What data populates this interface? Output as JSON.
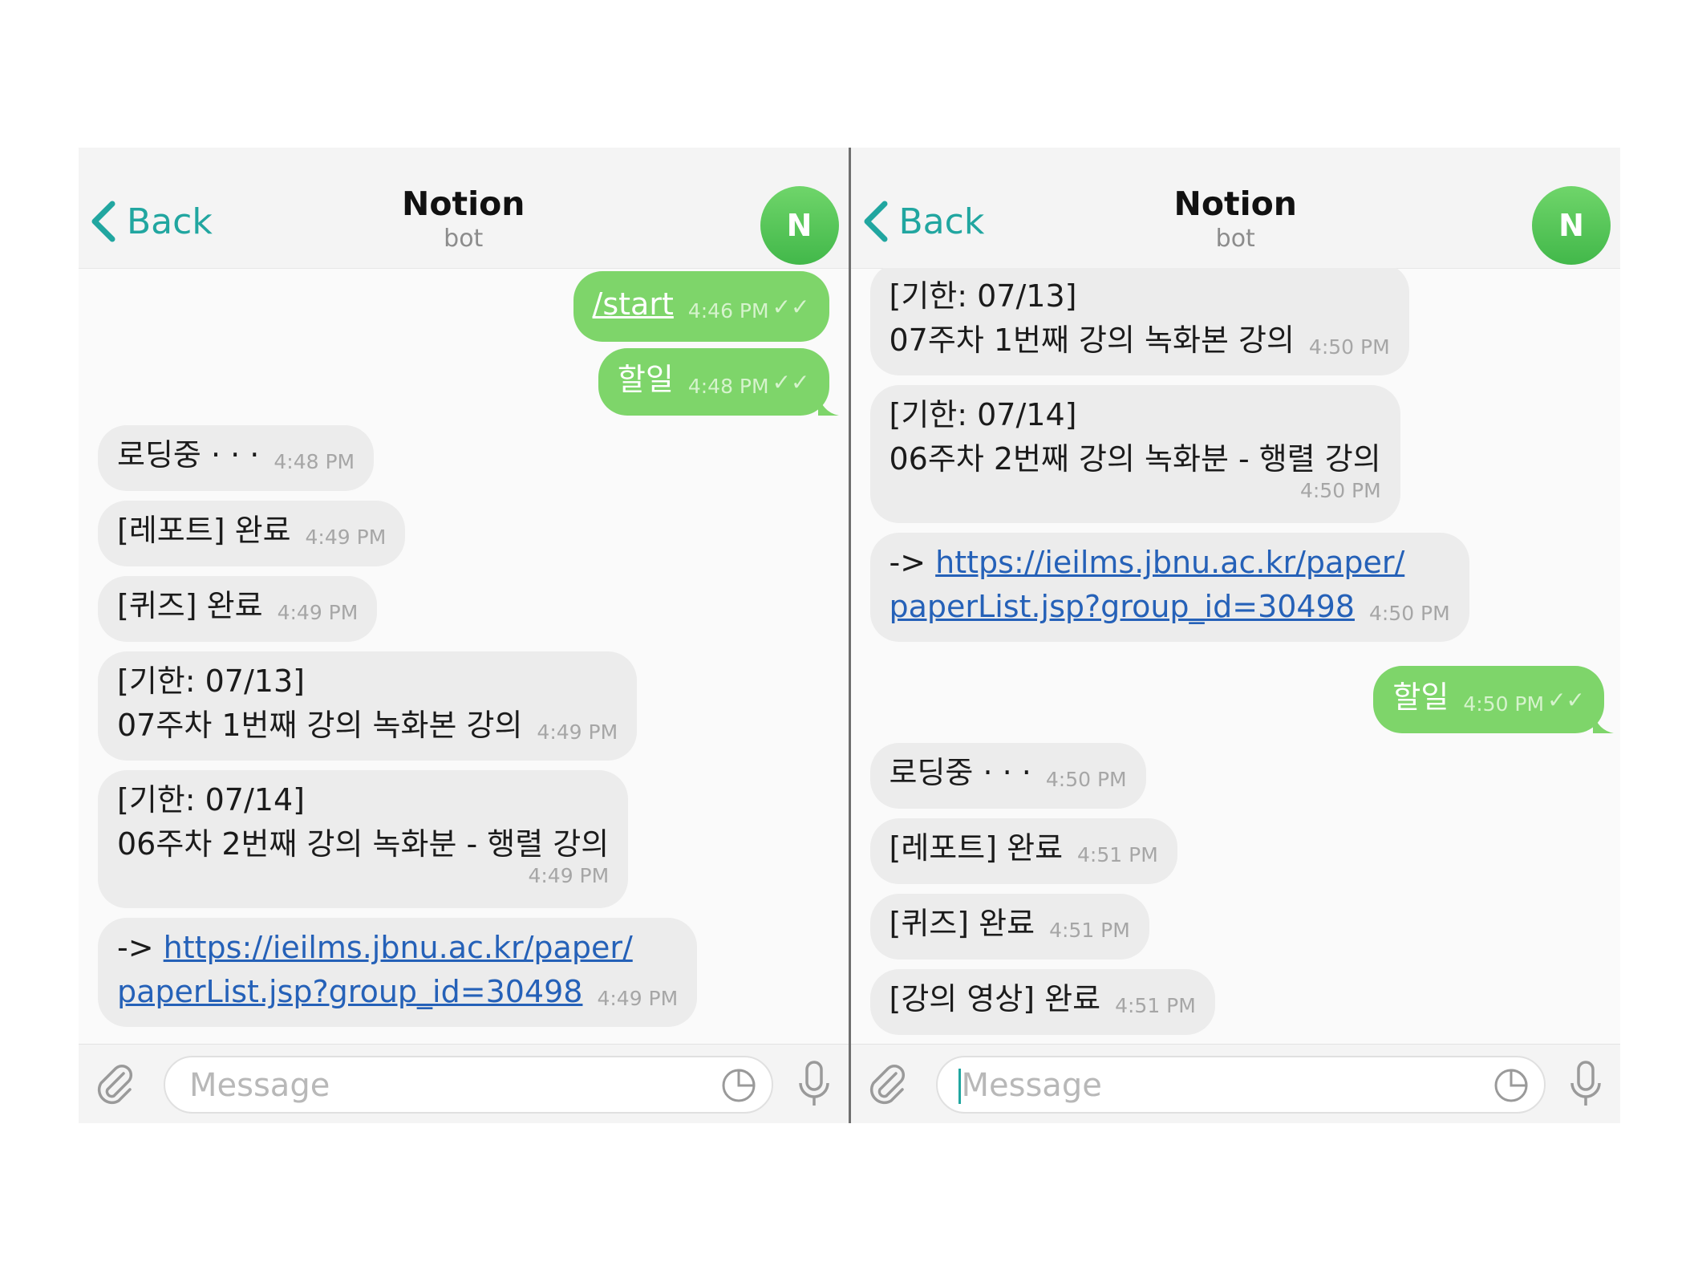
{
  "screens": [
    {
      "header": {
        "back_label": "Back",
        "title": "Notion",
        "subtitle": "bot",
        "avatar_letter": "N"
      },
      "messages": {
        "m1": {
          "text": "/start",
          "time": "4:46 PM"
        },
        "m2": {
          "text": "할일",
          "time": "4:48 PM"
        },
        "m3": {
          "text": "로딩중 · · ·",
          "time": "4:48 PM"
        },
        "m4": {
          "text": "[레포트] 완료",
          "time": "4:49 PM"
        },
        "m5": {
          "text": "[퀴즈] 완료",
          "time": "4:49 PM"
        },
        "m6": {
          "line1": "[기한: 07/13]",
          "line2": "07주차 1번째 강의 녹화본 강의",
          "time": "4:49 PM"
        },
        "m7": {
          "line1": "[기한: 07/14]",
          "line2": "06주차 2번째 강의 녹화분 - 행렬 강의",
          "time": "4:49 PM"
        },
        "m8": {
          "prefix": "-> ",
          "link1": "https://ieilms.jbnu.ac.kr/paper/",
          "link2": "paperList.jsp?group_id=30498",
          "time": "4:49 PM"
        }
      },
      "input": {
        "placeholder": "Message"
      }
    },
    {
      "header": {
        "back_label": "Back",
        "title": "Notion",
        "subtitle": "bot",
        "avatar_letter": "N"
      },
      "messages": {
        "m1": {
          "line1": "[기한: 07/13]",
          "line2": "07주차 1번째 강의 녹화본 강의",
          "time": "4:50 PM"
        },
        "m2": {
          "line1": "[기한: 07/14]",
          "line2": "06주차 2번째 강의 녹화분 - 행렬 강의",
          "time": "4:50 PM"
        },
        "m3": {
          "prefix": "-> ",
          "link1": "https://ieilms.jbnu.ac.kr/paper/",
          "link2": "paperList.jsp?group_id=30498",
          "time": "4:50 PM"
        },
        "m4": {
          "text": "할일",
          "time": "4:50 PM"
        },
        "m5": {
          "text": "로딩중 · · ·",
          "time": "4:50 PM"
        },
        "m6": {
          "text": "[레포트] 완료",
          "time": "4:51 PM"
        },
        "m7": {
          "text": "[퀴즈] 완료",
          "time": "4:51 PM"
        },
        "m8": {
          "text": "[강의 영상] 완료",
          "time": "4:51 PM"
        }
      },
      "input": {
        "placeholder": "Message"
      }
    }
  ],
  "icons": {
    "back": "chevron-left-icon",
    "attach": "paperclip-icon",
    "sticker": "sticker-icon",
    "mic": "microphone-icon",
    "read": "double-check-icon"
  },
  "colors": {
    "accent": "#21a6a0",
    "outgoing_bubble": "#7ed56a",
    "incoming_bubble": "#ececec",
    "link": "#2561b8",
    "avatar": "#4cc151"
  }
}
